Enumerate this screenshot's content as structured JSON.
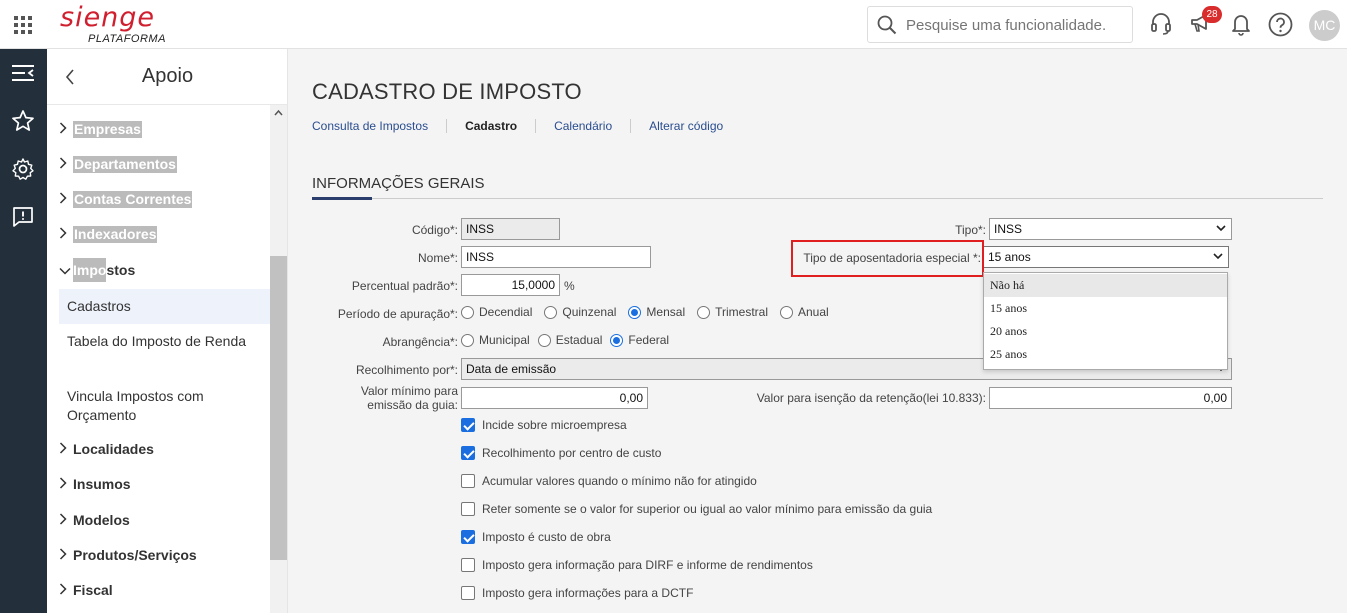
{
  "app": {
    "logo": "sienge",
    "logo_sub": "PLATAFORMA"
  },
  "search": {
    "placeholder": "Pesquise uma funcionalidade."
  },
  "topbar": {
    "notifications_badge": "28",
    "avatar_initials": "MC"
  },
  "sidebar": {
    "title": "Apoio",
    "items": [
      {
        "label": "Empresas",
        "expanded": false
      },
      {
        "label": "Departamentos",
        "expanded": false
      },
      {
        "label": "Contas Correntes",
        "expanded": false
      },
      {
        "label": "Indexadores",
        "expanded": false
      },
      {
        "label_hl": "Impo",
        "label_rest": "stos",
        "expanded": true
      },
      {
        "label": "Localidades",
        "expanded": false
      },
      {
        "label": "Insumos",
        "expanded": false
      },
      {
        "label": "Modelos",
        "expanded": false
      },
      {
        "label": "Produtos/Serviços",
        "expanded": false
      },
      {
        "label": "Fiscal",
        "expanded": false
      }
    ],
    "subitems": [
      {
        "label": "Cadastros",
        "active": true
      },
      {
        "label": "Tabela do Imposto de Renda",
        "active": false
      },
      {
        "label": "Vincula Impostos com Orçamento",
        "active": false
      }
    ]
  },
  "page": {
    "title": "CADASTRO DE IMPOSTO",
    "tabs": [
      "Consulta de Impostos",
      "Cadastro",
      "Calendário",
      "Alterar código"
    ],
    "section": "INFORMAÇÕES GERAIS"
  },
  "form": {
    "codigo": {
      "label": "Código*:",
      "value": "INSS"
    },
    "nome": {
      "label": "Nome*:",
      "value": "INSS"
    },
    "percentual": {
      "label": "Percentual padrão*:",
      "value": "15,0000",
      "unit": "%"
    },
    "periodo": {
      "label": "Período de apuração*:",
      "options": [
        "Decendial",
        "Quinzenal",
        "Mensal",
        "Trimestral",
        "Anual"
      ],
      "selected": "Mensal"
    },
    "abrangencia": {
      "label": "Abrangência*:",
      "options": [
        "Municipal",
        "Estadual",
        "Federal"
      ],
      "selected": "Federal"
    },
    "recolhimento": {
      "label": "Recolhimento por*:",
      "value": "Data de emissão"
    },
    "valor_minimo": {
      "label_line1": "Valor mínimo para",
      "label_line2": "emissão da guia:",
      "value": "0,00"
    },
    "tipo": {
      "label": "Tipo*:",
      "value": "INSS"
    },
    "aposentadoria": {
      "label": "Tipo de aposentadoria especial *:",
      "value": "15 anos",
      "options": [
        "Não há",
        "15 anos",
        "20 anos",
        "25 anos"
      ],
      "hover": "Não há"
    },
    "isencao": {
      "label": "Valor para isenção da retenção(lei 10.833):",
      "value": "0,00"
    },
    "checkboxes": [
      {
        "label": "Incide sobre microempresa",
        "checked": true
      },
      {
        "label": "Recolhimento por centro de custo",
        "checked": true
      },
      {
        "label": "Acumular valores quando o mínimo não for atingido",
        "checked": false
      },
      {
        "label": "Reter somente se o valor for superior ou igual ao valor mínimo para emissão da guia",
        "checked": false
      },
      {
        "label": "Imposto é custo de obra",
        "checked": true
      },
      {
        "label": "Imposto gera informação para DIRF e informe de rendimentos",
        "checked": false
      },
      {
        "label": "Imposto gera informações para a DCTF",
        "checked": false
      }
    ]
  },
  "colors": {
    "brand": "#d02030",
    "accent": "#1a6ee0",
    "rail": "#232f3a",
    "highlight_box": "#e02020"
  }
}
